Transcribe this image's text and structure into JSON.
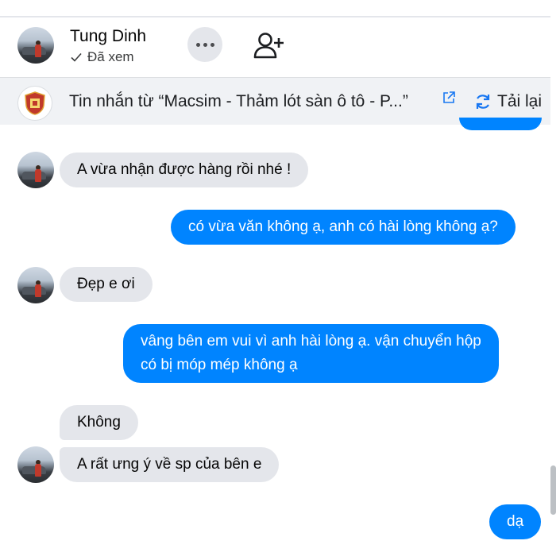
{
  "header": {
    "contact_name": "Tung Dinh",
    "status": "Đã xem"
  },
  "source_bar": {
    "text": "Tin nhắn từ  “Macsim - Thảm lót sàn ô tô - P...”",
    "reload_label": "Tải lại"
  },
  "messages": [
    {
      "side": "in",
      "text": "A vừa nhận được hàng rồi nhé !"
    },
    {
      "side": "out",
      "text": "có vừa văn không ạ, anh có hài lòng không ạ?"
    },
    {
      "side": "in",
      "text": "Đẹp e ơi"
    },
    {
      "side": "out",
      "line1": "vâng bên em vui vì anh hài lòng ạ. vận chuyển hộp",
      "line2": "có bị móp mép không ạ"
    },
    {
      "side": "in",
      "text": "Không"
    },
    {
      "side": "in",
      "text": "A rất ưng ý về sp của bên e"
    },
    {
      "side": "out",
      "text": "dạ"
    }
  ],
  "colors": {
    "outgoing_bubble": "#0084ff",
    "incoming_bubble": "#e4e6eb",
    "source_bar_bg": "#f0f2f5",
    "reload_icon": "#1877f2"
  }
}
